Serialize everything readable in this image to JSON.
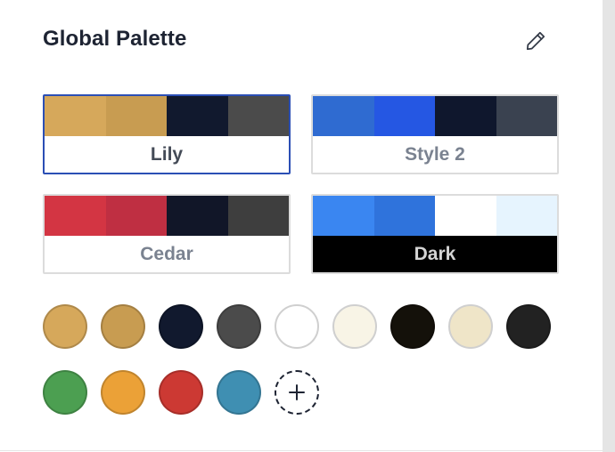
{
  "panel": {
    "title": "Global Palette",
    "edit_icon": "pencil-icon",
    "add_icon": "plus-icon"
  },
  "palettes": [
    {
      "name": "Lily",
      "selected": true,
      "dark": false,
      "colors": [
        "#D6A85B",
        "#C89C51",
        "#11192E",
        "#4B4B4B"
      ]
    },
    {
      "name": "Style 2",
      "selected": false,
      "dark": false,
      "colors": [
        "#2F6BD1",
        "#2557E3",
        "#0F172D",
        "#3A4250"
      ]
    },
    {
      "name": "Cedar",
      "selected": false,
      "dark": false,
      "colors": [
        "#D33543",
        "#BF2F42",
        "#111628",
        "#3E3E3E"
      ]
    },
    {
      "name": "Dark",
      "selected": false,
      "dark": true,
      "colors": [
        "#3A86F1",
        "#2F73DC",
        "#FFFFFF",
        "#E6F4FE"
      ]
    }
  ],
  "global_colors": [
    "#D6A85B",
    "#C89C51",
    "#11192E",
    "#4B4B4B",
    "#FFFFFF",
    "#F8F4E6",
    "#14110A",
    "#EFE5C8",
    "#222222",
    "#4C9F51",
    "#EBA137",
    "#CC3933",
    "#3F8FB2"
  ]
}
